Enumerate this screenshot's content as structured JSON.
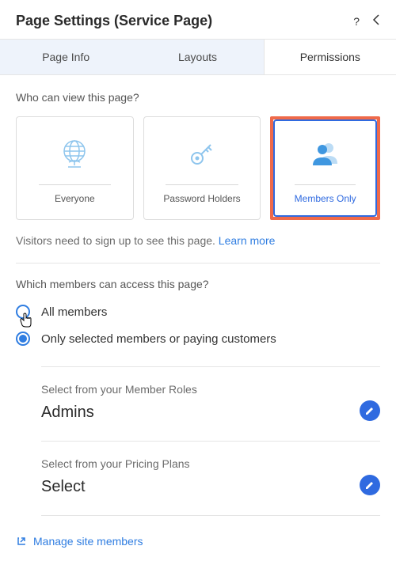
{
  "header": {
    "title": "Page Settings (Service Page)"
  },
  "tabs": {
    "info": "Page Info",
    "layouts": "Layouts",
    "permissions": "Permissions"
  },
  "viewSection": {
    "title": "Who can view this page?",
    "options": {
      "everyone": "Everyone",
      "password": "Password Holders",
      "members": "Members Only"
    },
    "hintPrefix": "Visitors need to sign up to see this page. ",
    "hintLink": "Learn more"
  },
  "accessSection": {
    "title": "Which members can access this page?",
    "radios": {
      "all": "All members",
      "selected": "Only selected members or paying customers"
    }
  },
  "roles": {
    "label": "Select from your Member Roles",
    "value": "Admins"
  },
  "plans": {
    "label": "Select from your Pricing Plans",
    "value": "Select"
  },
  "footer": {
    "manage": "Manage site members"
  }
}
